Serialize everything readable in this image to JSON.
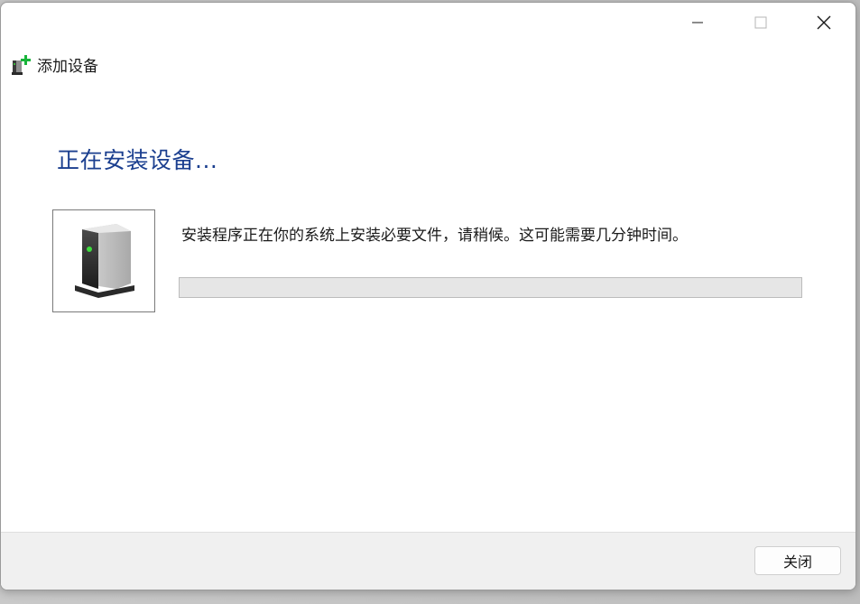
{
  "window": {
    "title": "添加设备",
    "icon": "add-device-icon",
    "controls": [
      "minimize-icon",
      "maximize-icon",
      "close-icon"
    ]
  },
  "main": {
    "heading": "正在安装设备...",
    "device_icon": "device-icon",
    "message": "安装程序正在你的系统上安装必要文件，请稍候。这可能需要几分钟时间。",
    "progress": 0
  },
  "footer": {
    "close_label": "关闭"
  },
  "colors": {
    "heading": "#1b3f8f",
    "progress_track": "#e6e6e6",
    "footer_bg": "#f0f0f0"
  }
}
